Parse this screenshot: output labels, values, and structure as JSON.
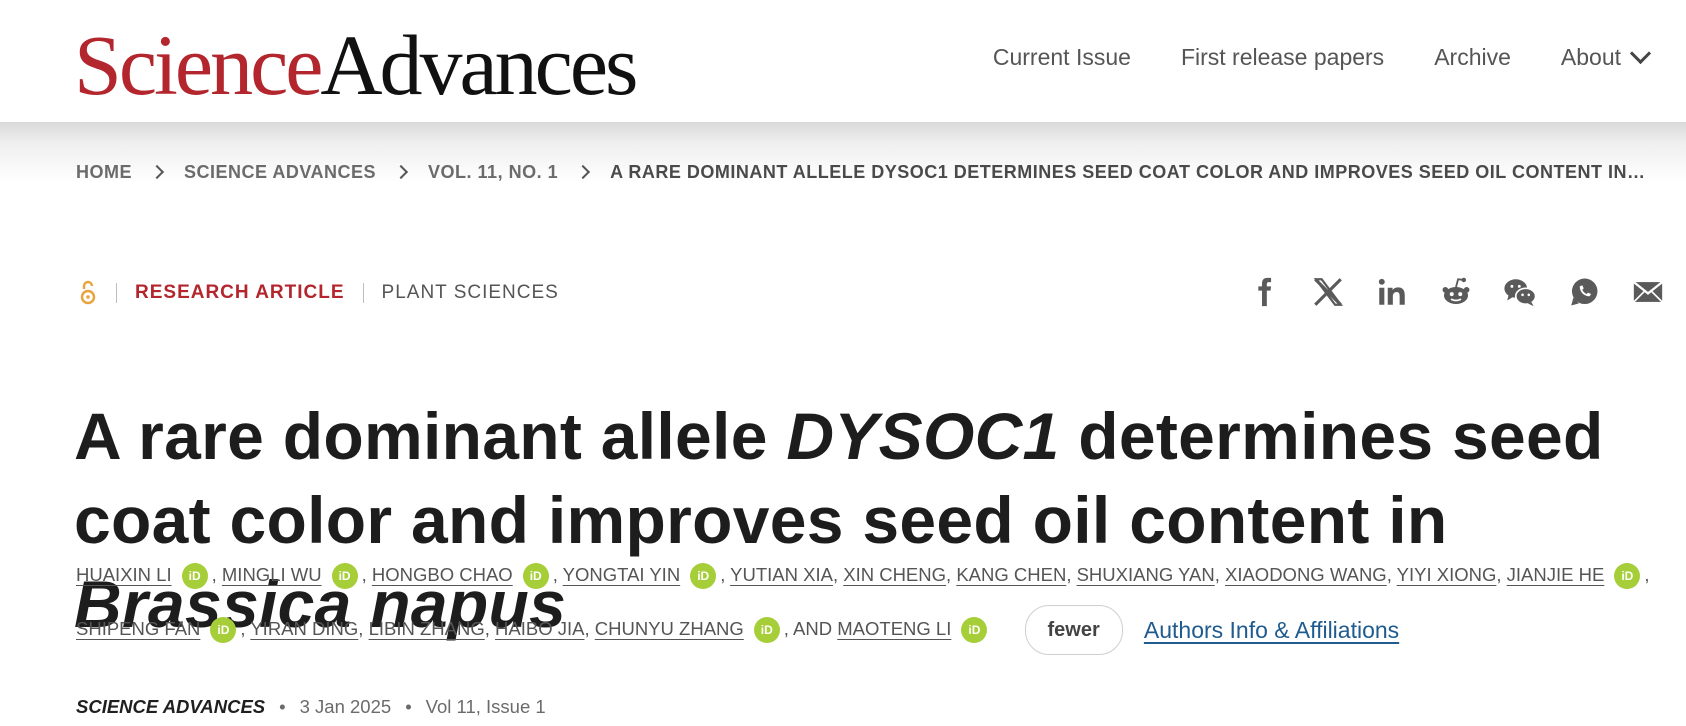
{
  "header": {
    "logo_science": "Science",
    "logo_advances": "Advances",
    "nav": [
      {
        "label": "Current Issue"
      },
      {
        "label": "First release papers"
      },
      {
        "label": "Archive"
      },
      {
        "label": "About"
      }
    ]
  },
  "breadcrumb": [
    "HOME",
    "SCIENCE ADVANCES",
    "VOL. 11, NO. 1",
    "A RARE DOMINANT ALLELE DYSOC1 DETERMINES SEED COAT COLOR AND IMPROVES SEED OIL CONTENT IN…"
  ],
  "article": {
    "type": "RESEARCH ARTICLE",
    "subject": "PLANT SCIENCES",
    "title_part1": "A rare dominant allele ",
    "title_gene": "DYSOC1",
    "title_part2": " determines seed coat color and improves seed oil content in ",
    "title_species": "Brassica napus",
    "authors_sep": ",",
    "authors_and": ", AND",
    "authors": [
      {
        "name": "HUAIXIN LI",
        "orcid": true
      },
      {
        "name": "MINGLI WU",
        "orcid": true
      },
      {
        "name": "HONGBO CHAO",
        "orcid": true
      },
      {
        "name": "YONGTAI YIN",
        "orcid": true
      },
      {
        "name": "YUTIAN XIA",
        "orcid": false
      },
      {
        "name": "XIN CHENG",
        "orcid": false
      },
      {
        "name": "KANG CHEN",
        "orcid": false
      },
      {
        "name": "SHUXIANG YAN",
        "orcid": false
      },
      {
        "name": "XIAODONG WANG",
        "orcid": false
      },
      {
        "name": "YIYI XIONG",
        "orcid": false
      },
      {
        "name": "JIANJIE HE",
        "orcid": true
      },
      {
        "name": "SHIPENG FAN",
        "orcid": true
      },
      {
        "name": "YIRAN DING",
        "orcid": false
      },
      {
        "name": "LIBIN ZHANG",
        "orcid": false
      },
      {
        "name": "HAIBO JIA",
        "orcid": false
      },
      {
        "name": "CHUNYU ZHANG",
        "orcid": true
      },
      {
        "name": "MAOTENG LI",
        "orcid": true
      }
    ],
    "orcid_label": "iD",
    "fewer_label": "fewer",
    "affiliations_label": "Authors Info & Affiliations",
    "journal": "SCIENCE ADVANCES",
    "date": "3 Jan 2025",
    "volume": "Vol 11, Issue 1",
    "meta_dot": "•"
  },
  "share_icons": [
    "facebook-icon",
    "x-icon",
    "linkedin-icon",
    "reddit-icon",
    "wechat-icon",
    "whatsapp-icon",
    "email-icon"
  ],
  "colors": {
    "brand_red": "#b3262d",
    "orcid_green": "#a6ce39",
    "link_blue": "#1f5b8e",
    "open_access_orange": "#e8a33d"
  }
}
